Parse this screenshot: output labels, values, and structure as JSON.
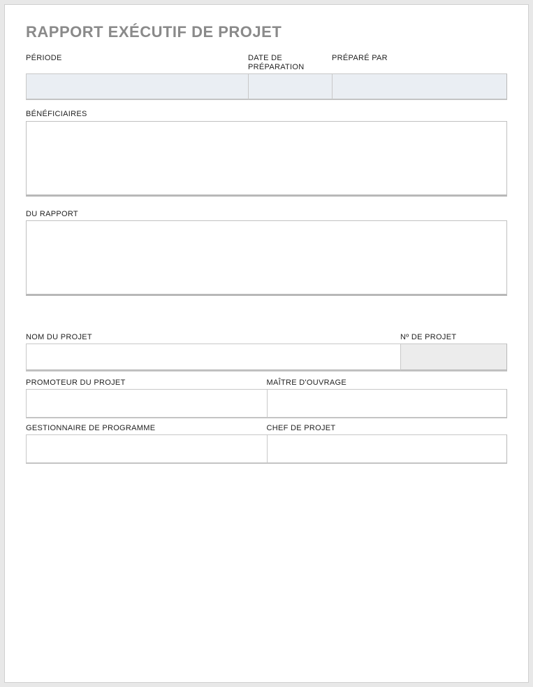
{
  "title": "RAPPORT EXÉCUTIF DE PROJET",
  "header": {
    "period_label": "PÉRIODE",
    "prep_date_label": "DATE DE PRÉPARATION",
    "prepared_by_label": "PRÉPARÉ PAR",
    "period_value": "",
    "prep_date_value": "",
    "prepared_by_value": ""
  },
  "beneficiaries": {
    "label": "BÉNÉFICIAIRES",
    "value": ""
  },
  "report": {
    "label": "DU RAPPORT",
    "value": ""
  },
  "project": {
    "name_label": "NOM DU PROJET",
    "number_label": "Nº DE PROJET",
    "name_value": "",
    "number_value": ""
  },
  "row_sponsor": {
    "left_label": "PROMOTEUR DU PROJET",
    "right_label": "MAÎTRE D'OUVRAGE",
    "left_value": "",
    "right_value": ""
  },
  "row_manager": {
    "left_label": "GESTIONNAIRE DE PROGRAMME",
    "right_label": "CHEF DE PROJET",
    "left_value": "",
    "right_value": ""
  }
}
